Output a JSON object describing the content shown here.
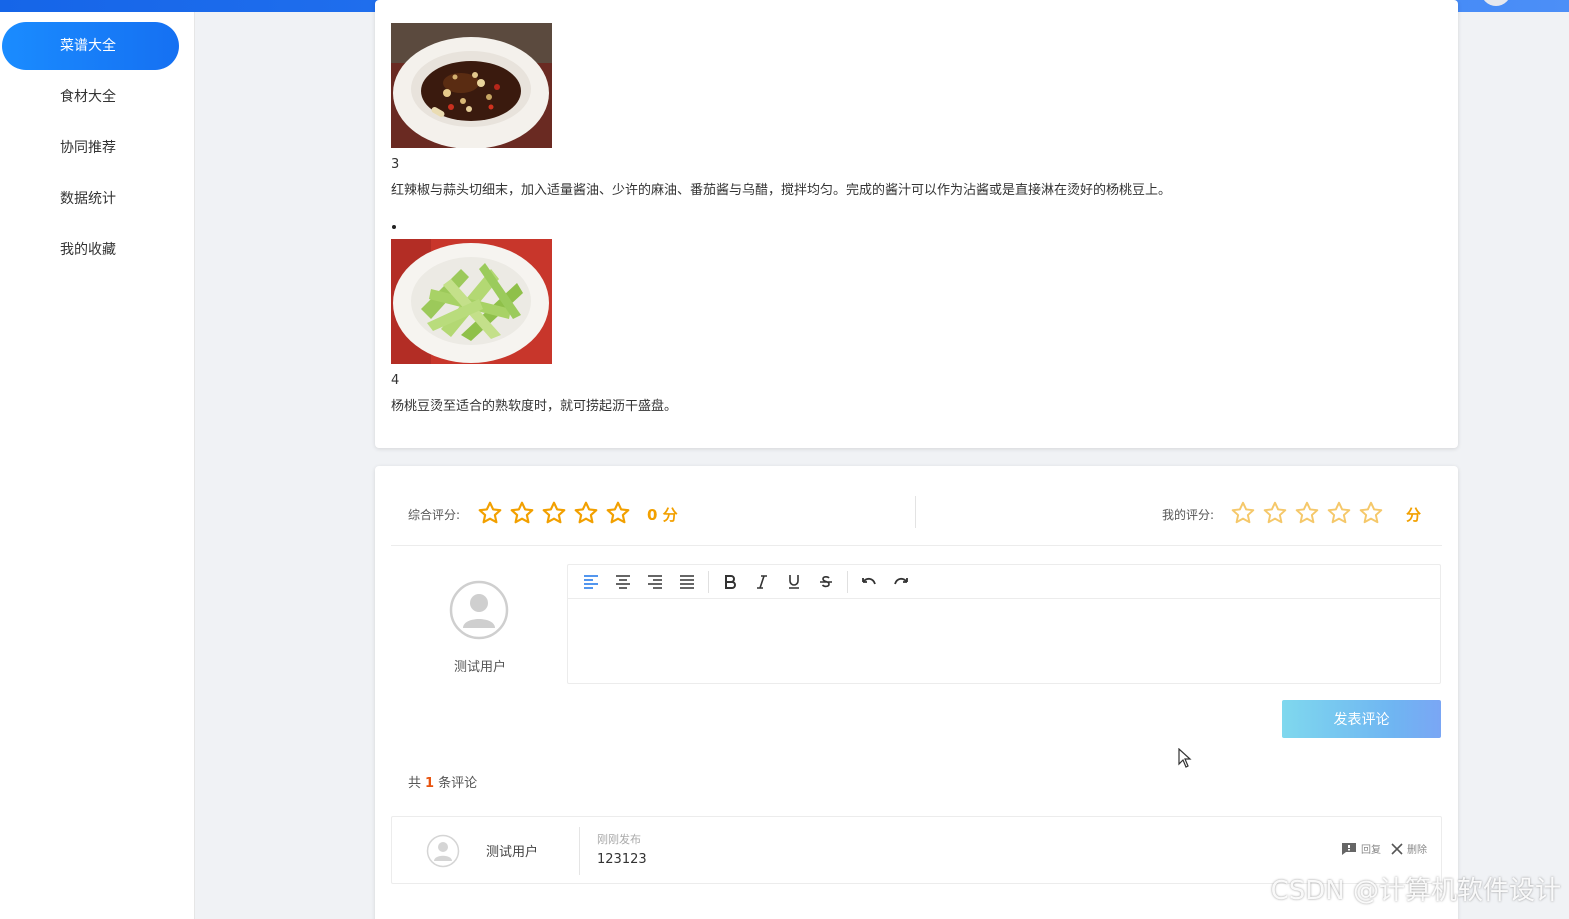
{
  "sidebar": {
    "items": [
      {
        "label": "菜谱大全",
        "active": true
      },
      {
        "label": "食材大全"
      },
      {
        "label": "协同推荐"
      },
      {
        "label": "数据统计"
      },
      {
        "label": "我的收藏"
      }
    ]
  },
  "steps": [
    {
      "number": "3",
      "text": "红辣椒与蒜头切细末，加入适量酱油、少许的麻油、番茄酱与乌醋，搅拌均匀。完成的酱汁可以作为沾酱或是直接淋在烫好的杨桃豆上。",
      "image": "sauce-bowl-photo"
    },
    {
      "number": "4",
      "text": "杨桃豆烫至适合的熟软度时，就可捞起沥干盛盘。",
      "image": "winged-beans-plate-photo"
    }
  ],
  "rating": {
    "overall_label": "综合评分:",
    "overall_score": "0 分",
    "my_label": "我的评分:",
    "my_score": "分",
    "star_color_overall": "#f2a000",
    "star_color_mine": "#f5c86a"
  },
  "composer": {
    "user_name": "测试用户",
    "submit_label": "发表评论",
    "toolbar": [
      "align-left-icon",
      "align-center-icon",
      "align-right-icon",
      "align-justify-icon",
      "bold-icon",
      "italic-icon",
      "underline-icon",
      "strikethrough-icon",
      "undo-icon",
      "redo-icon"
    ]
  },
  "comments": {
    "count_prefix": "共",
    "count": "1",
    "count_suffix": "条评论",
    "items": [
      {
        "user": "测试用户",
        "time": "刚刚发布",
        "content": "123123",
        "reply_label": "回复",
        "delete_label": "删除"
      }
    ]
  },
  "watermark": "CSDN @计算机软件设计",
  "colors": {
    "primary": "#1a8cff",
    "accent": "#f2a000",
    "count_color": "#e8540f"
  }
}
